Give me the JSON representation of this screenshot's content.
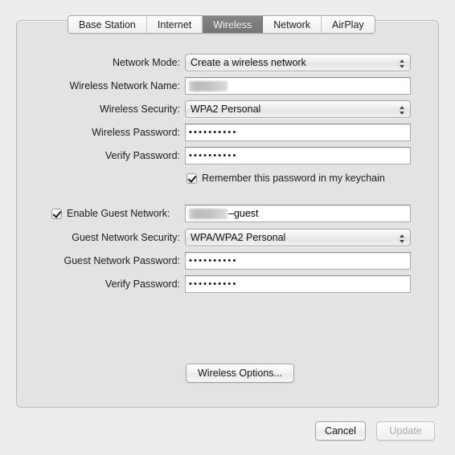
{
  "window": {
    "background_color": "#ededed",
    "panel_color": "#e3e3e3"
  },
  "tabs": [
    {
      "label": "Base Station",
      "selected": false
    },
    {
      "label": "Internet",
      "selected": false
    },
    {
      "label": "Wireless",
      "selected": true
    },
    {
      "label": "Network",
      "selected": false
    },
    {
      "label": "AirPlay",
      "selected": false
    }
  ],
  "wireless": {
    "network_mode": {
      "label": "Network Mode:",
      "value": "Create a wireless network"
    },
    "network_name": {
      "label": "Wireless Network Name:",
      "value": "",
      "redacted": true,
      "suffix": ""
    },
    "security": {
      "label": "Wireless Security:",
      "value": "WPA2 Personal"
    },
    "password": {
      "label": "Wireless Password:",
      "value": "••••••••••"
    },
    "verify_password": {
      "label": "Verify Password:",
      "value": "••••••••••"
    },
    "remember_keychain": {
      "label": "Remember this password in my keychain",
      "checked": true
    }
  },
  "guest": {
    "enable": {
      "label": "Enable Guest Network:",
      "checked": true
    },
    "network_name": {
      "value": "",
      "redacted": true,
      "suffix": "–guest"
    },
    "security": {
      "label": "Guest Network Security:",
      "value": "WPA/WPA2 Personal"
    },
    "password": {
      "label": "Guest Network Password:",
      "value": "••••••••••"
    },
    "verify_password": {
      "label": "Verify Password:",
      "value": "••••••••••"
    }
  },
  "buttons": {
    "wireless_options": {
      "label": "Wireless Options...",
      "enabled": true
    },
    "cancel": {
      "label": "Cancel",
      "enabled": true
    },
    "update": {
      "label": "Update",
      "enabled": false
    }
  }
}
